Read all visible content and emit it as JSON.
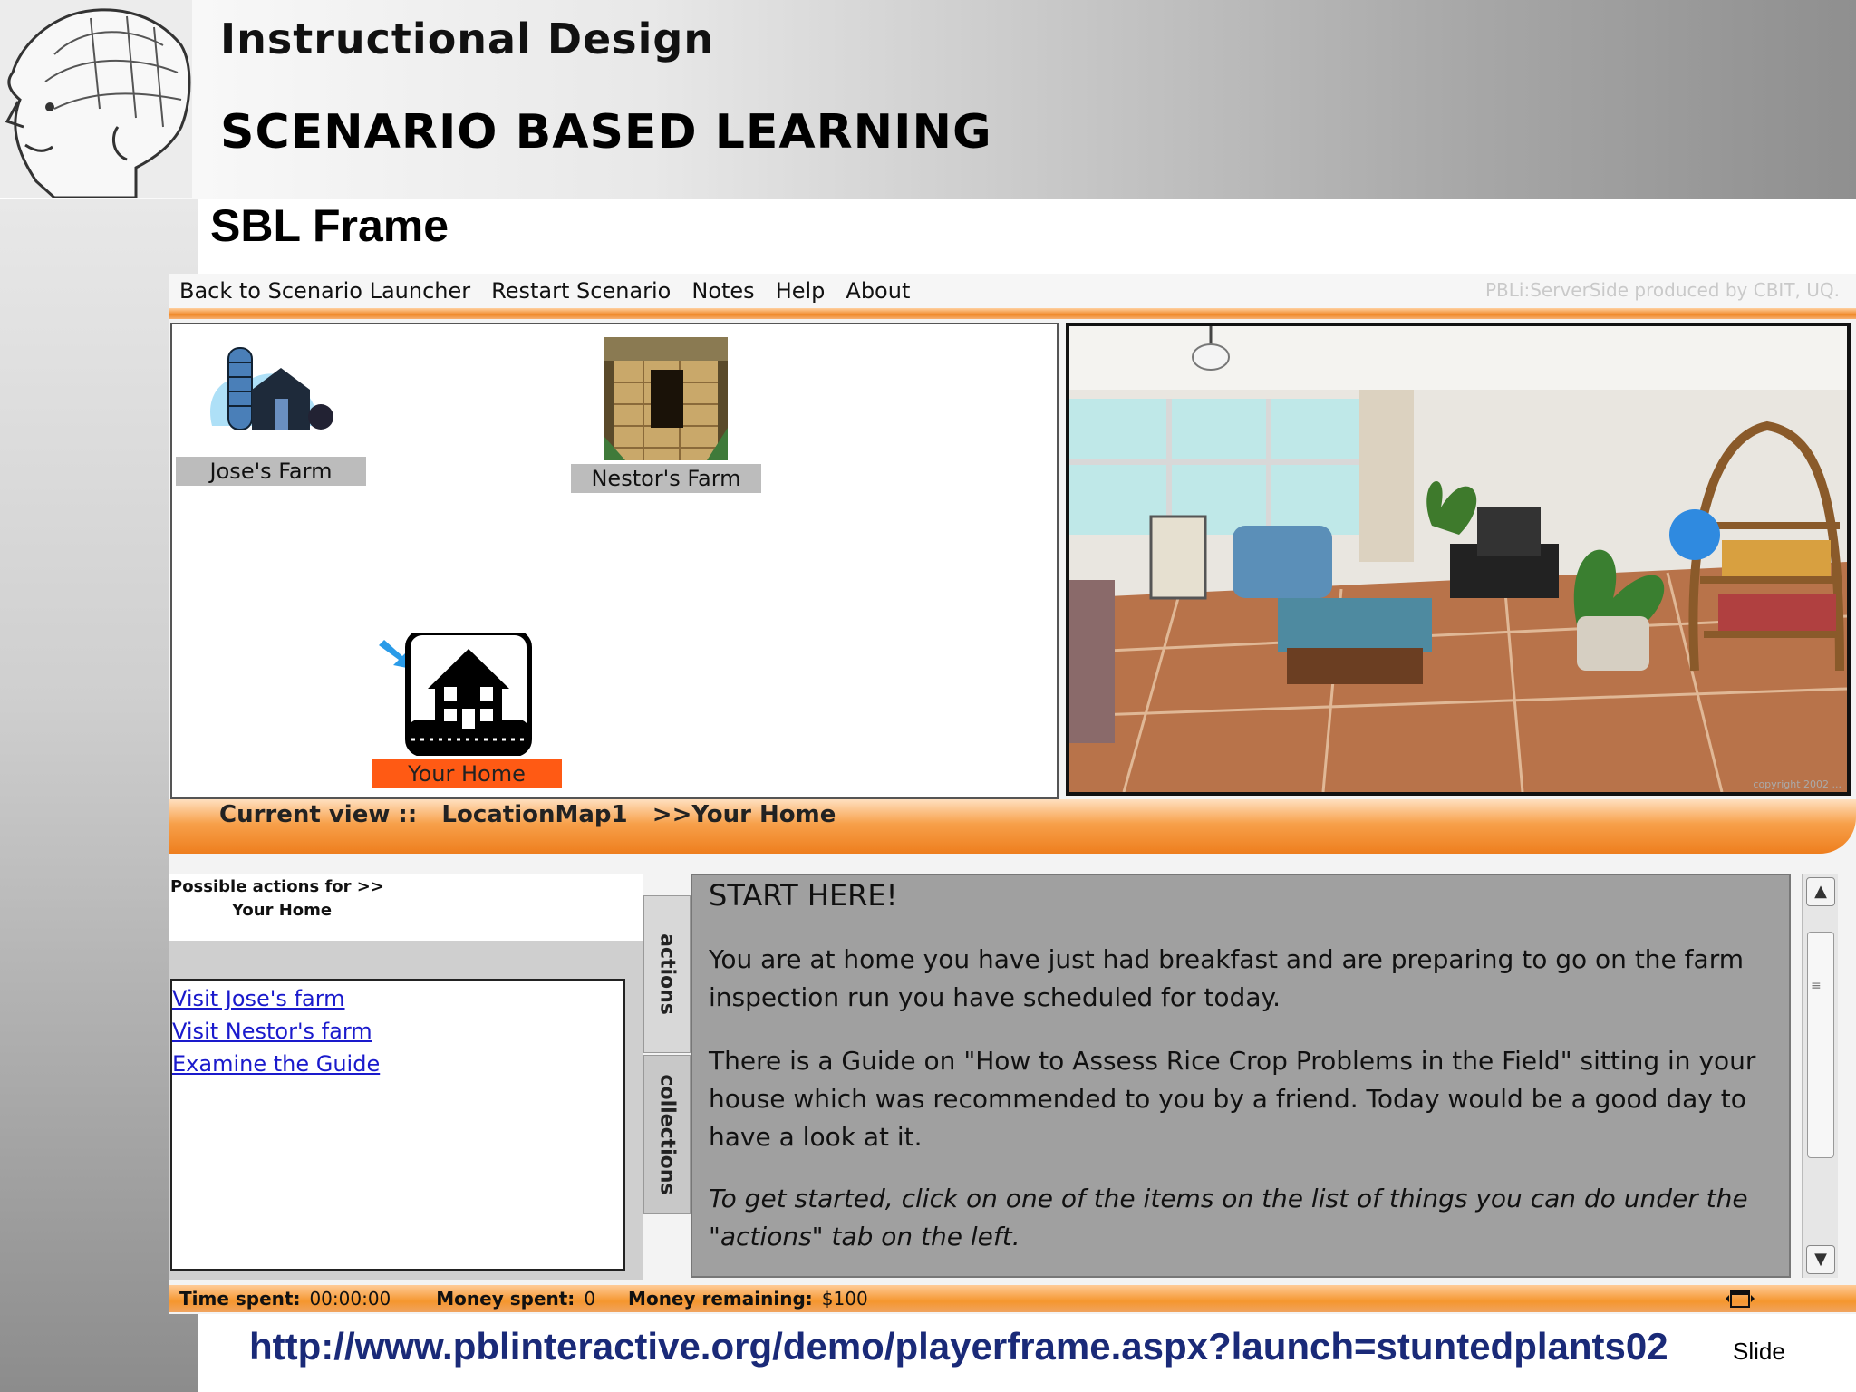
{
  "slide": {
    "title": "Instructional Design",
    "subtitle": "SCENARIO BASED LEARNING",
    "frame_title": "SBL Frame",
    "url": "http://www.pblinteractive.org/demo/playerframe.aspx?launch=stuntedplants02",
    "slide_label": "Slide"
  },
  "app": {
    "menu": [
      "Back to Scenario Launcher",
      "Restart Scenario",
      "Notes",
      "Help",
      "About"
    ],
    "credit": "PBLi:ServerSide produced by CBIT, UQ.",
    "map": {
      "locations": [
        {
          "label": "Jose's Farm",
          "icon": "farm-icon",
          "active": false
        },
        {
          "label": "Nestor's Farm",
          "icon": "hut-photo-icon",
          "active": false
        },
        {
          "label": "Your Home",
          "icon": "house-icon",
          "active": true
        }
      ]
    },
    "photo": {
      "copyright": "copyright 2002 ..."
    },
    "view_bar": {
      "prefix": "Current view ::",
      "map_name": "LocationMap1",
      "location": ">>Your Home"
    },
    "actions": {
      "header_line1": "Possible actions for >>",
      "header_line2": "Your Home",
      "items": [
        "Visit Jose's farm ",
        "Visit Nestor's farm",
        "Examine the Guide "
      ],
      "tabs": [
        "actions",
        "collections"
      ]
    },
    "story": {
      "heading": "START HERE!",
      "p1": "You are at home you have just had breakfast and are preparing to go on the farm inspection run you have scheduled for today.",
      "p2": "There is a Guide on \"How to Assess Rice Crop Problems in the Field\" sitting in your house which was recommended to you by a friend.  Today would be a good day to have a look at it.",
      "p3": "To get started, click on one of the items on the list of things you can do under the \"actions\" tab on the left."
    },
    "status": {
      "time_label": "Time spent:",
      "time_value": "00:00:00",
      "money_spent_label": "Money spent:",
      "money_spent_value": "0",
      "money_remaining_label": "Money remaining:",
      "money_remaining_value": "$100"
    },
    "colors": {
      "accent_orange": "#f08a2a",
      "active_location": "#ff5a14",
      "link_blue": "#1a1acc",
      "url_navy": "#1a2a78"
    }
  }
}
